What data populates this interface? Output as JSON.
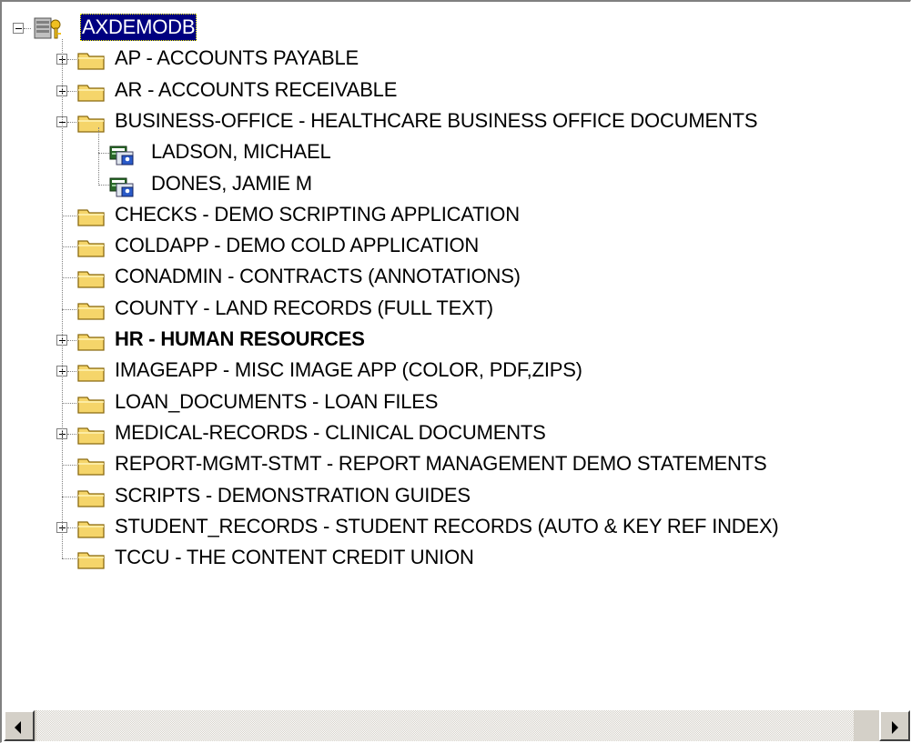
{
  "tree": {
    "root": {
      "label": "AXDEMODB",
      "icon": "database-key-icon",
      "expanded": true,
      "selected": true
    },
    "items": [
      {
        "label": "AP - ACCOUNTS PAYABLE",
        "icon": "folder-icon",
        "expander": "plus",
        "level": 1
      },
      {
        "label": "AR - ACCOUNTS RECEIVABLE",
        "icon": "folder-icon",
        "expander": "plus",
        "level": 1
      },
      {
        "label": "BUSINESS-OFFICE - HEALTHCARE BUSINESS OFFICE DOCUMENTS",
        "icon": "folder-icon",
        "expander": "minus",
        "level": 1
      },
      {
        "label": "LADSON, MICHAEL",
        "icon": "user-document-icon",
        "expander": "none",
        "level": 2
      },
      {
        "label": "DONES, JAMIE M",
        "icon": "user-document-icon",
        "expander": "none",
        "level": 2
      },
      {
        "label": "CHECKS - DEMO SCRIPTING APPLICATION",
        "icon": "folder-icon",
        "expander": "none",
        "level": 1
      },
      {
        "label": "COLDAPP - DEMO COLD APPLICATION",
        "icon": "folder-icon",
        "expander": "none",
        "level": 1
      },
      {
        "label": "CONADMIN - CONTRACTS (ANNOTATIONS)",
        "icon": "folder-icon",
        "expander": "none",
        "level": 1
      },
      {
        "label": "COUNTY - LAND RECORDS (FULL TEXT)",
        "icon": "folder-icon",
        "expander": "none",
        "level": 1
      },
      {
        "label": "HR - HUMAN RESOURCES",
        "icon": "folder-icon",
        "expander": "plus",
        "level": 1,
        "bold": true
      },
      {
        "label": "IMAGEAPP - MISC IMAGE APP (COLOR, PDF,ZIPS)",
        "icon": "folder-icon",
        "expander": "plus",
        "level": 1
      },
      {
        "label": "LOAN_DOCUMENTS - LOAN FILES",
        "icon": "folder-icon",
        "expander": "none",
        "level": 1
      },
      {
        "label": "MEDICAL-RECORDS - CLINICAL DOCUMENTS",
        "icon": "folder-icon",
        "expander": "plus",
        "level": 1
      },
      {
        "label": "REPORT-MGMT-STMT - REPORT MANAGEMENT DEMO STATEMENTS",
        "icon": "folder-icon",
        "expander": "none",
        "level": 1
      },
      {
        "label": "SCRIPTS - DEMONSTRATION GUIDES",
        "icon": "folder-icon",
        "expander": "none",
        "level": 1
      },
      {
        "label": "STUDENT_RECORDS - STUDENT RECORDS (AUTO & KEY REF INDEX)",
        "icon": "folder-icon",
        "expander": "plus",
        "level": 1
      },
      {
        "label": "TCCU - THE CONTENT CREDIT UNION",
        "icon": "folder-icon",
        "expander": "none",
        "level": 1
      }
    ]
  },
  "scrollbar": {
    "left_icon": "scroll-left-arrow-icon",
    "right_icon": "scroll-right-arrow-icon"
  },
  "colors": {
    "selection": "#000080",
    "folder": "#f5d56a",
    "tree_lines": "#808080",
    "scrollbar_face": "#d4d0c8"
  }
}
